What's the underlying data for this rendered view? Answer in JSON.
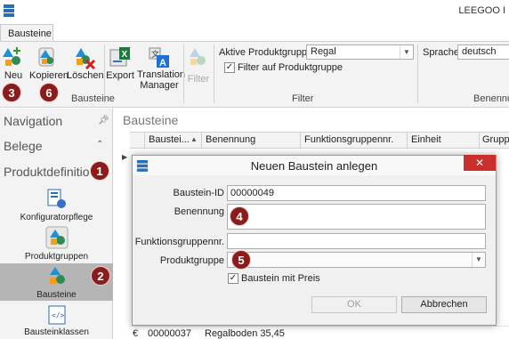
{
  "window": {
    "title": "LEEGOO I"
  },
  "tabs": [
    {
      "label": "Bausteine"
    }
  ],
  "ribbon": {
    "new_label": "Neu",
    "copy_label": "Kopieren",
    "delete_label": "Löschen",
    "export_label": "Export",
    "translation_label_1": "Translation",
    "translation_label_2": "Manager",
    "filter_label": "Filter",
    "group_bausteine": "Bausteine",
    "group_filter": "Filter",
    "group_benennung": "Benennun",
    "active_group_label": "Aktive Produktgruppe",
    "active_group_value": "Regal",
    "filter_check_label": "Filter auf Produktgruppe",
    "filter_checked": true,
    "language_label": "Sprache",
    "language_value": "deutsch"
  },
  "navigation": {
    "header": "Navigation",
    "belege": "Belege",
    "produktdef": "Produktdefinitio",
    "items": [
      {
        "label": "Konfiguratorpflege"
      },
      {
        "label": "Produktgruppen"
      },
      {
        "label": "Bausteine"
      },
      {
        "label": "Bausteinklassen"
      }
    ]
  },
  "main": {
    "title": "Bausteine",
    "columns": [
      "Baustei...",
      "Benennung",
      "Funktionsgruppennr.",
      "Einheit",
      "Grupp"
    ],
    "bottom_row": {
      "currency": "€",
      "id": "00000037",
      "name": "Regalboden 35,45"
    }
  },
  "dialog": {
    "title": "Neuen Baustein anlegen",
    "close": "✕",
    "id_label": "Baustein-ID",
    "id_value": "00000049",
    "name_label": "Benennung",
    "name_value": "",
    "func_label": "Funktionsgruppennr.",
    "func_value": "",
    "group_label": "Produktgruppe",
    "group_value": "",
    "price_label": "Baustein mit Preis",
    "price_checked": true,
    "ok_label": "OK",
    "cancel_label": "Abbrechen"
  },
  "badges": [
    "3",
    "6",
    "1",
    "2",
    "4",
    "5"
  ],
  "colors": {
    "badge": "#8a1c1c",
    "close": "#c9302c",
    "selected_nav": "#b5b5b5"
  }
}
